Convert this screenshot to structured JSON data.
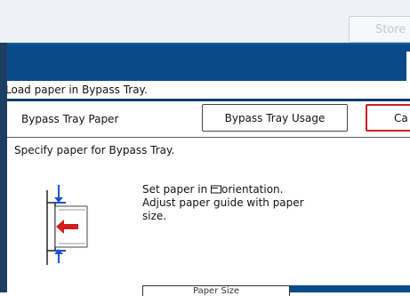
{
  "header": {
    "store_label": "Store"
  },
  "band": {
    "message": "Load paper in Bypass Tray."
  },
  "tabs": {
    "current_label": "Bypass Tray Paper",
    "usage_button_label": "Bypass Tray Usage",
    "cancel_label": "Ca"
  },
  "content": {
    "specify_text": "Specify paper for Bypass Tray.",
    "instructions": [
      "Set paper in",
      "orientation.",
      "Adjust paper guide with paper",
      "size."
    ]
  },
  "bottom": {
    "tab_label": "Paper Size"
  },
  "colors": {
    "band": "#0a4a8a",
    "cancel_border": "#d01e1e",
    "arrow_blue": "#1b54d1",
    "arrow_red": "#d01e1e"
  }
}
